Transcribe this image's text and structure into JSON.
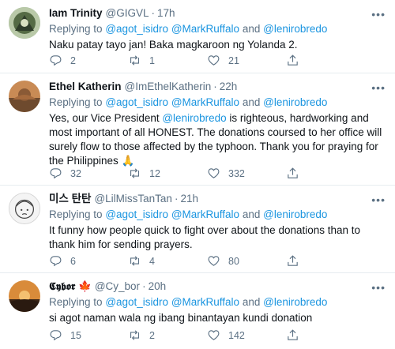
{
  "tweets": [
    {
      "name": "Iam Trinity",
      "handle": "@GIGVL",
      "time": "17h",
      "replying_prefix": "Replying to",
      "mention1": "@agot_isidro",
      "mention2": "@MarkRuffalo",
      "and": "and",
      "mention3": "@lenirobredo",
      "text": "Naku patay tayo jan! Baka magkaroon ng Yolanda 2.",
      "replies": "2",
      "retweets": "1",
      "likes": "21"
    },
    {
      "name": "Ethel Katherin",
      "handle": "@ImEthelKatherin",
      "time": "22h",
      "replying_prefix": "Replying to",
      "mention1": "@agot_isidro",
      "mention2": "@MarkRuffalo",
      "and": "and",
      "mention3": "@lenirobredo",
      "text_before": "Yes, our Vice President ",
      "text_mention": "@lenirobredo",
      "text_after": " is righteous, hardworking and most important of all HONEST.  The donations coursed to her office will surely flow to those affected by the typhoon.  Thank you for praying for the Philippines 🙏",
      "replies": "32",
      "retweets": "12",
      "likes": "332"
    },
    {
      "name": "미스 탄탄",
      "handle": "@LilMissTanTan",
      "time": "21h",
      "replying_prefix": "Replying to",
      "mention1": "@agot_isidro",
      "mention2": "@MarkRuffalo",
      "and": "and",
      "mention3": "@lenirobredo",
      "text": "It funny how people quick to fight over about the donations than to thank him for sending prayers.",
      "replies": "6",
      "retweets": "4",
      "likes": "80"
    },
    {
      "name": "𝕮𝖞𝖇𝖔𝖗 🍁",
      "handle": "@Cy_bor",
      "time": "20h",
      "replying_prefix": "Replying to",
      "mention1": "@agot_isidro",
      "mention2": "@MarkRuffalo",
      "and": "and",
      "mention3": "@lenirobredo",
      "text": "si agot naman wala ng ibang binantayan kundi donation",
      "replies": "15",
      "retweets": "2",
      "likes": "142"
    }
  ],
  "colors": {
    "link": "#1b95e0",
    "secondary": "#5b7083",
    "divider": "#e6ecf0",
    "text": "#0f1419"
  },
  "icons": [
    "avatar",
    "more-icon",
    "reply-icon",
    "retweet-icon",
    "like-icon",
    "share-icon"
  ]
}
